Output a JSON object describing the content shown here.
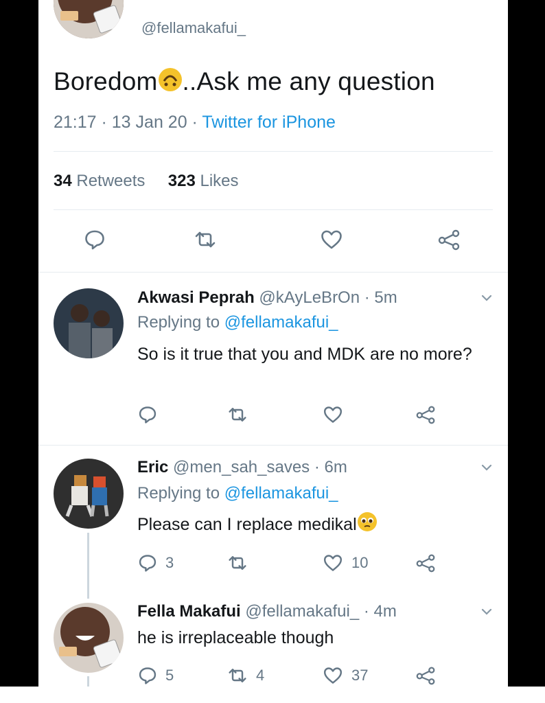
{
  "main_tweet": {
    "handle": "@fellamakafui_",
    "text_before": "Boredom",
    "text_after": "..Ask me any question",
    "time": "21:17",
    "sep1": " · ",
    "date": "13 Jan 20",
    "sep2": " · ",
    "source": "Twitter for iPhone",
    "retweets_count": "34",
    "retweets_label": " Retweets",
    "likes_count": "323",
    "likes_label": " Likes",
    "emoji_icon": "upside-down-face-emoji"
  },
  "replies": [
    {
      "name": "Akwasi Peprah",
      "handle": "@kAyLeBrOn",
      "time": "· 5m",
      "replying_prefix": "Replying to ",
      "replying_to": "@fellamakafui_",
      "text": "So is it true that you and MDK are no more?",
      "reply_count": "",
      "retweet_count": "",
      "like_count": ""
    },
    {
      "name": "Eric",
      "handle": "@men_sah_saves",
      "time": "· 6m",
      "replying_prefix": "Replying to ",
      "replying_to": "@fellamakafui_",
      "text": "Please can I replace medikal",
      "emoji_icon": "pleading-face-emoji",
      "reply_count": "3",
      "retweet_count": "",
      "like_count": "10"
    },
    {
      "name": "Fella Makafui",
      "handle": "@fellamakafui_",
      "time": "· 4m",
      "text": "he is irreplaceable though",
      "reply_count": "5",
      "retweet_count": "4",
      "like_count": "37"
    }
  ],
  "colors": {
    "text": "#14171a",
    "muted": "#657786",
    "link": "#1b95e0",
    "divider": "#e6ecf0",
    "icon": "#657786"
  }
}
